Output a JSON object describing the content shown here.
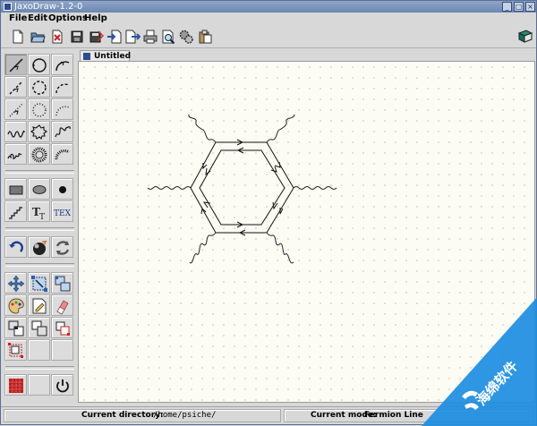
{
  "window": {
    "title": "JaxoDraw-1.2-0"
  },
  "menu": {
    "items": [
      "File",
      "Edit",
      "Options",
      "Help"
    ]
  },
  "tab": {
    "label": "Untitled"
  },
  "status": {
    "directory_label": "Current directory:",
    "directory_value": "/home/psiche/",
    "mode_label": "Current mode:",
    "mode_value": "Fermion Line"
  },
  "tools": {
    "text_tool_label": "T",
    "tex_tool_label": "TEX"
  },
  "watermark": {
    "text": "海绵软件"
  },
  "colors": {
    "title_bar": "#7b93bb",
    "canvas": "#fcfcf4",
    "selection_red": "#cc2222",
    "watermark_blue": "#1c8de0"
  }
}
